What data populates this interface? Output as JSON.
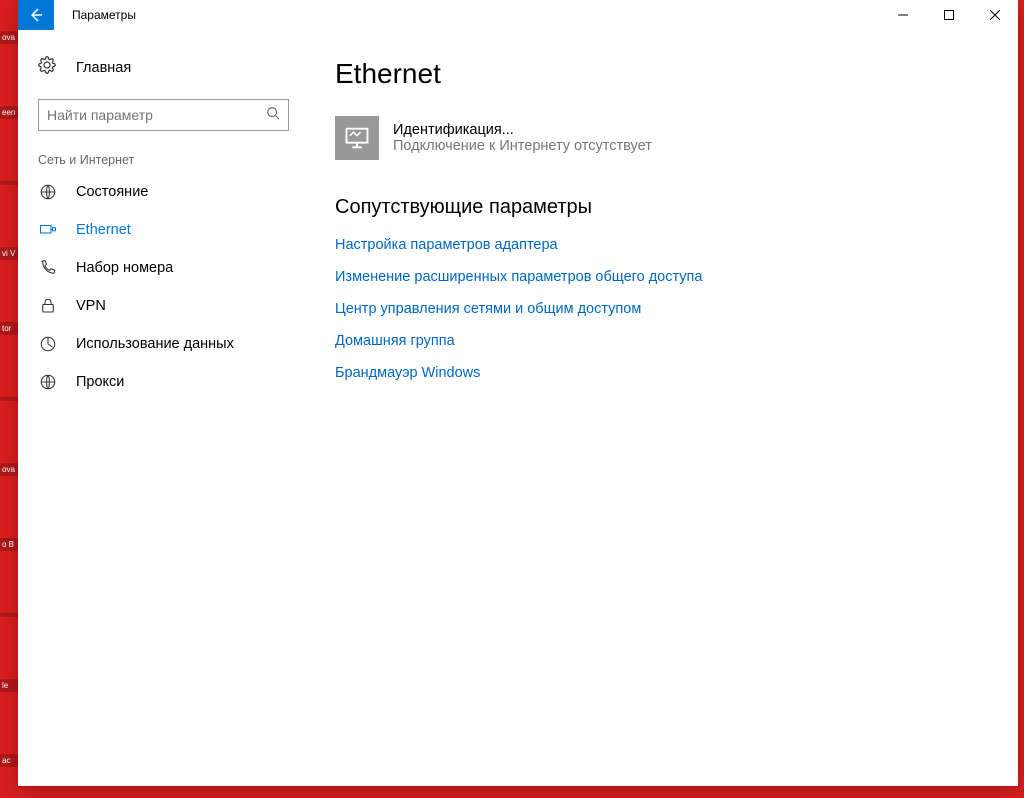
{
  "window": {
    "title": "Параметры"
  },
  "sidebar": {
    "home": "Главная",
    "search_placeholder": "Найти параметр",
    "section": "Сеть и Интернет",
    "items": [
      {
        "label": "Состояние",
        "icon": "status"
      },
      {
        "label": "Ethernet",
        "icon": "ethernet"
      },
      {
        "label": "Набор номера",
        "icon": "dialup"
      },
      {
        "label": "VPN",
        "icon": "vpn"
      },
      {
        "label": "Использование данных",
        "icon": "data"
      },
      {
        "label": "Прокси",
        "icon": "proxy"
      }
    ]
  },
  "main": {
    "heading": "Ethernet",
    "network": {
      "name": "Идентификация...",
      "status": "Подключение к Интернету отсутствует"
    },
    "related_heading": "Сопутствующие параметры",
    "links": [
      "Настройка параметров адаптера",
      "Изменение расширенных параметров общего доступа",
      "Центр управления сетями и общим доступом",
      "Домашняя группа",
      "Брандмауэр Windows"
    ]
  }
}
